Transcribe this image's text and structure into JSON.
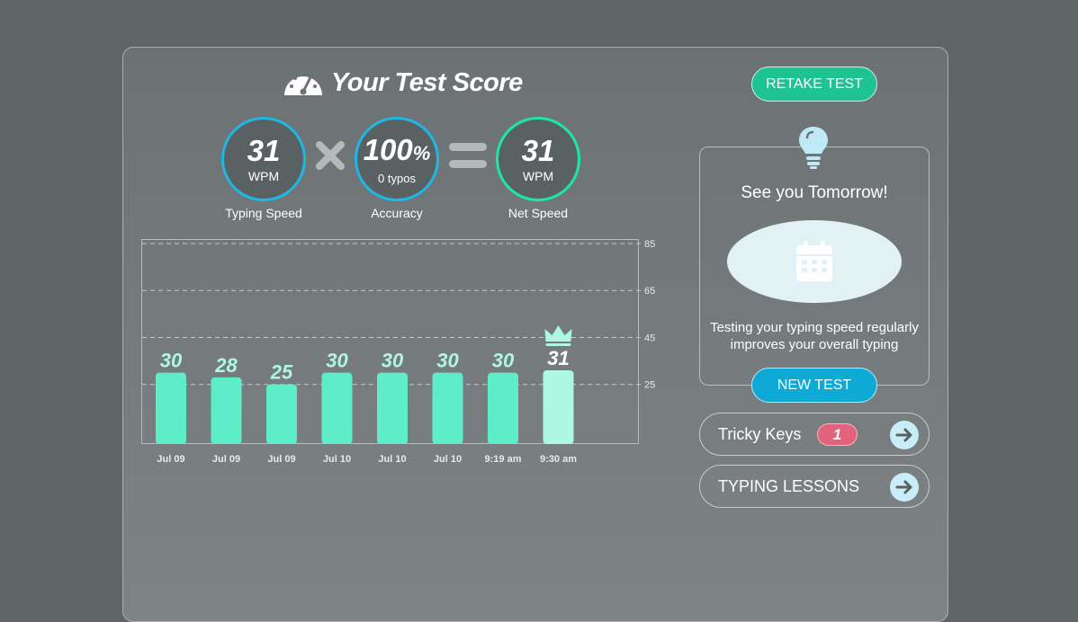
{
  "header": {
    "title": "Your Test Score",
    "retake_label": "RETAKE TEST"
  },
  "scores": {
    "speed": {
      "value": "31",
      "unit": "WPM",
      "label": "Typing Speed"
    },
    "accuracy": {
      "value": "100",
      "suffix": "%",
      "unit": "0 typos",
      "label": "Accuracy"
    },
    "net": {
      "value": "31",
      "unit": "WPM",
      "label": "Net Speed"
    }
  },
  "chart_data": {
    "type": "bar",
    "categories": [
      "Jul 09",
      "Jul 09",
      "Jul 09",
      "Jul 10",
      "Jul 10",
      "Jul 10",
      "9:19 am",
      "9:30 am"
    ],
    "values": [
      30,
      28,
      25,
      30,
      30,
      30,
      30,
      31
    ],
    "ylim": [
      0,
      85
    ],
    "gridlines": [
      25,
      45,
      65,
      85
    ],
    "grid": true,
    "highlight_index": 7,
    "bar_color": "#5eedc9",
    "highlight_color": "#aef7e3"
  },
  "card": {
    "title": "See you Tomorrow!",
    "description_line1": "Testing your typing speed regularly",
    "description_line2": "improves your overall typing",
    "new_test_label": "NEW TEST"
  },
  "links": {
    "tricky_keys_label": "Tricky Keys",
    "tricky_keys_count": "1",
    "lessons_label": "TYPING LESSONS"
  },
  "colors": {
    "accent_teal": "#1ec394",
    "accent_blue": "#0eaad6",
    "badge_pink": "#e4637c",
    "circle_blue": "#1eb8e6",
    "circle_green": "#1ee6a8"
  }
}
